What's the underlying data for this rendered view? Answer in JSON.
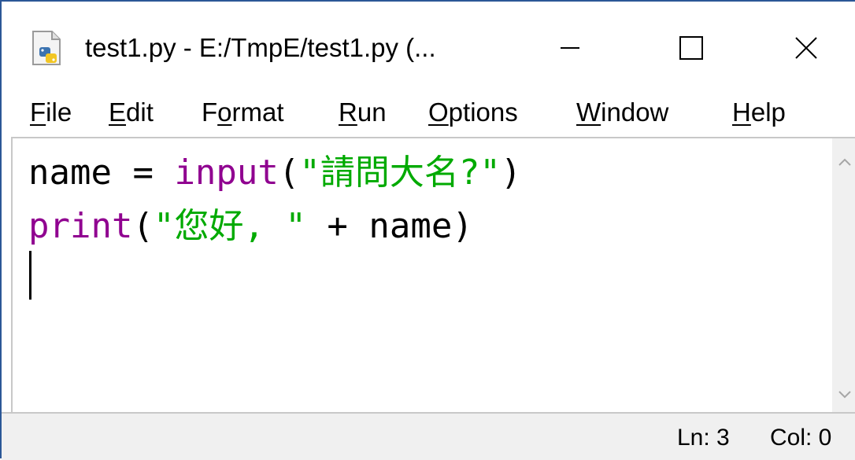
{
  "window": {
    "title": "test1.py - E:/TmpE/test1.py (...",
    "icon": "python-file-icon"
  },
  "controls": {
    "minimize_icon": "minimize-icon",
    "maximize_icon": "maximize-icon",
    "close_icon": "close-icon"
  },
  "menu": {
    "items": [
      {
        "mn": "F",
        "rest": "ile"
      },
      {
        "mn": "E",
        "rest": "dit"
      },
      {
        "pre": "F",
        "mn": "o",
        "rest": "rmat"
      },
      {
        "mn": "R",
        "rest": "un"
      },
      {
        "mn": "O",
        "rest": "ptions"
      },
      {
        "mn": "W",
        "rest": "indow"
      },
      {
        "mn": "H",
        "rest": "elp"
      }
    ]
  },
  "editor": {
    "lines": [
      {
        "tokens": [
          {
            "text": "name = ",
            "kind": "default"
          },
          {
            "text": "input",
            "kind": "builtin"
          },
          {
            "text": "(",
            "kind": "default"
          },
          {
            "text": "\"請問大名?\"",
            "kind": "string"
          },
          {
            "text": ")",
            "kind": "default"
          }
        ]
      },
      {
        "tokens": [
          {
            "text": "print",
            "kind": "builtin"
          },
          {
            "text": "(",
            "kind": "default"
          },
          {
            "text": "\"您好, \"",
            "kind": "string"
          },
          {
            "text": " + name)",
            "kind": "default"
          }
        ]
      }
    ]
  },
  "status": {
    "line": "Ln: 3",
    "col": "Col: 0"
  },
  "colors": {
    "builtin": "#900090",
    "string": "#00aa00",
    "default": "#000000",
    "window_border": "#2b5797"
  }
}
